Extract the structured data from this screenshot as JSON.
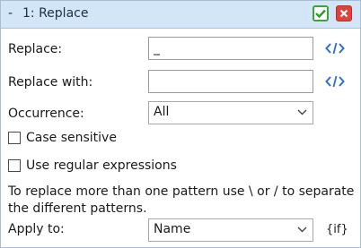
{
  "titlebar": {
    "collapse": "-",
    "title": "1: Replace"
  },
  "replace": {
    "label": "Replace:",
    "value": "_"
  },
  "replace_with": {
    "label": "Replace with:",
    "value": ""
  },
  "occurrence": {
    "label": "Occurrence:",
    "selected": "All"
  },
  "options": {
    "case_sensitive": {
      "label": "Case sensitive",
      "checked": false
    },
    "regex": {
      "label": "Use regular expressions",
      "checked": false
    }
  },
  "help": {
    "line1": "To replace more than one pattern use \\ or / to separate",
    "line2": "the different patterns."
  },
  "apply_to": {
    "label": "Apply to:",
    "selected": "Name",
    "suffix": "{if}"
  },
  "colors": {
    "titlebar": "#d3e6f8",
    "accent_icon": "#2e6fc8",
    "ok": "#39a53b",
    "close": "#e2413a"
  },
  "icons": {
    "ok": "checkmark-icon",
    "close": "close-icon",
    "code": "code-icon",
    "dropdown": "chevron-down-icon"
  }
}
